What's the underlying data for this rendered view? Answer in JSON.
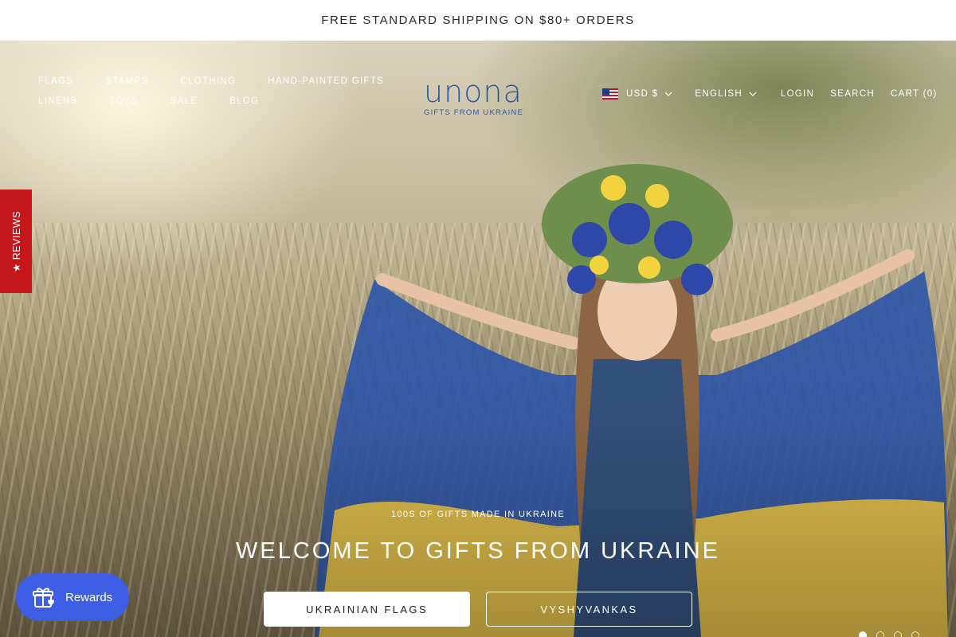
{
  "announcement": {
    "text": "FREE STANDARD SHIPPING ON $80+ ORDERS"
  },
  "nav": {
    "row1": [
      "FLAGS",
      "STAMPS",
      "CLOTHING",
      "HAND-PAINTED GIFTS"
    ],
    "row2": [
      "LINENS",
      "TOYS",
      "SALE",
      "BLOG"
    ]
  },
  "logo": {
    "word": "unona",
    "subtitle": "GIFTS FROM UKRAINE"
  },
  "header_right": {
    "currency": "USD $",
    "language": "ENGLISH",
    "login": "LOGIN",
    "search": "SEARCH",
    "cart": "CART (0)"
  },
  "reviews_tab": {
    "label": "★ REVIEWS"
  },
  "hero": {
    "eyebrow": "100S OF GIFTS MADE IN UKRAINE",
    "headline": "WELCOME TO GIFTS FROM UKRAINE",
    "primary_button": "UKRAINIAN FLAGS",
    "secondary_button": "VYSHYVANKAS"
  },
  "rewards": {
    "label": "Rewards"
  },
  "colors": {
    "brand_blue": "#2e59a8",
    "reviews_red": "#c5161c",
    "rewards_blue": "#3f5ee6"
  },
  "icons": [
    "us-flag-icon",
    "chevron-down-icon",
    "gift-icon",
    "star-icon"
  ]
}
